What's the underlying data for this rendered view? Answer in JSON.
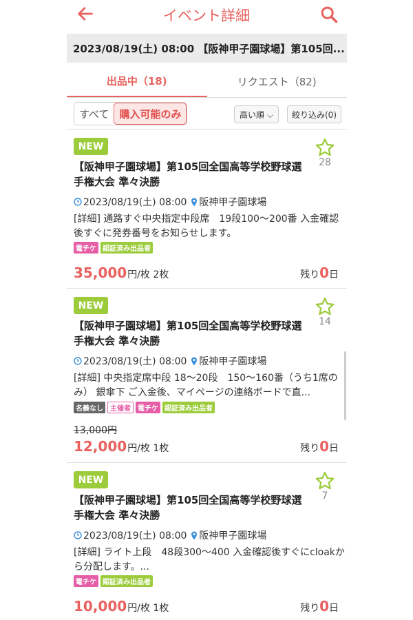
{
  "header": {
    "title": "イベント詳細",
    "back_icon": "arrow-left-icon",
    "search_icon": "search-icon",
    "accent": "#e8615f"
  },
  "event_bar": {
    "text": "2023/08/19(土) 08:00 【阪神甲子園球場】第105回..."
  },
  "tabs": [
    {
      "label": "出品中（18)",
      "active": true
    },
    {
      "label": "リクエスト（82)",
      "active": false
    }
  ],
  "filters": {
    "all": "すべて",
    "purchasable": "購入可能のみ",
    "sort": "高い順 ⌵",
    "narrow": "絞り込み(0)"
  },
  "listings": [
    {
      "badge": "NEW",
      "favorites": "28",
      "title": "【阪神甲子園球場】第105回全国高等学校野球選手権大会 準々決勝",
      "datetime": "2023/08/19(土) 08:00",
      "venue": "阪神甲子園球場",
      "detail": "[詳細] 通路すぐ中央指定中段席　19段100〜200番 入金確認後すぐに発券番号をお知らせします。",
      "tags": [
        "電チケ",
        "認証済み出品者"
      ],
      "old_price": "",
      "price": "35,000",
      "unit": "円/枚 2枚",
      "remain_prefix": "残り",
      "remain_num": "0",
      "remain_suffix": "日"
    },
    {
      "badge": "NEW",
      "favorites": "14",
      "title": "【阪神甲子園球場】第105回全国高等学校野球選手権大会 準々決勝",
      "datetime": "2023/08/19(土) 08:00",
      "venue": "阪神甲子園球場",
      "detail": "[詳細] 中央指定席中段 18〜20段　150〜160番（うち1席のみ） 銀傘下 ご入金後、マイページの連絡ボードで直...",
      "tags": [
        "名義なし",
        "主催者",
        "電チケ",
        "認証済み出品者"
      ],
      "old_price": "13,000円",
      "price": "12,000",
      "unit": "円/枚 1枚",
      "remain_prefix": "残り",
      "remain_num": "0",
      "remain_suffix": "日"
    },
    {
      "badge": "NEW",
      "favorites": "7",
      "title": "【阪神甲子園球場】第105回全国高等学校野球選手権大会 準々決勝",
      "datetime": "2023/08/19(土) 08:00",
      "venue": "阪神甲子園球場",
      "detail": "[詳細] ライト上段　48段300〜400 入金確認後すぐにcloakから分配します。...",
      "tags": [
        "電チケ",
        "認証済み出品者"
      ],
      "old_price": "",
      "price": "10,000",
      "unit": "円/枚 1枚",
      "remain_prefix": "残り",
      "remain_num": "0",
      "remain_suffix": "日"
    }
  ]
}
